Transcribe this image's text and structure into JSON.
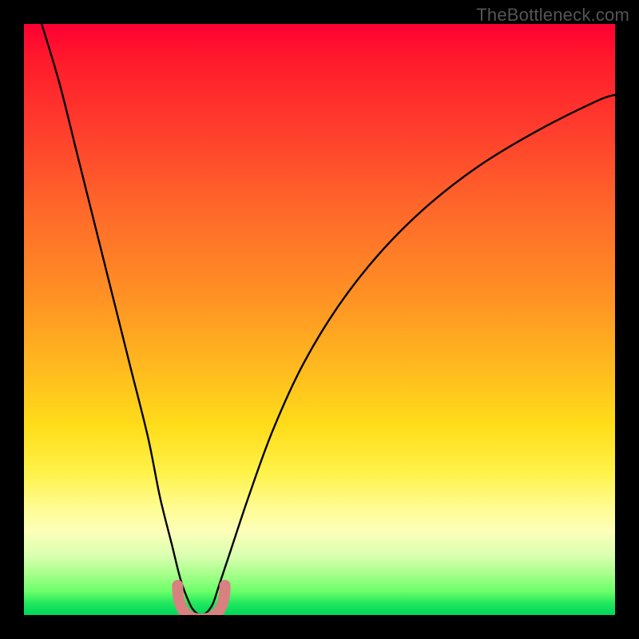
{
  "watermark": "TheBottleneck.com",
  "chart_data": {
    "type": "line",
    "title": "",
    "xlabel": "",
    "ylabel": "",
    "xlim": [
      0,
      100
    ],
    "ylim": [
      0,
      100
    ],
    "legend": false,
    "grid": false,
    "background_gradient": {
      "top": "#ff0033",
      "mid_upper": "#ff8a24",
      "mid": "#ffe61a",
      "mid_lower": "#fbffb9",
      "bottom": "#00d65a"
    },
    "series": [
      {
        "name": "bottleneck-curve",
        "color": "#000000",
        "x": [
          3,
          6,
          9,
          12,
          15,
          18,
          21,
          23,
          25,
          26.5,
          28,
          29,
          30,
          31,
          32,
          33,
          35,
          38,
          42,
          47,
          53,
          60,
          68,
          77,
          87,
          97,
          100
        ],
        "y": [
          100,
          90,
          78,
          66,
          54,
          42,
          30,
          20,
          12,
          6,
          2,
          0.5,
          0,
          0.5,
          2,
          5,
          11,
          20,
          31,
          42,
          52,
          61,
          69,
          76,
          82,
          87,
          88
        ]
      }
    ],
    "markers": [
      {
        "name": "trough-marker",
        "shape": "rounded-u",
        "color": "#d98080",
        "x_center": 30,
        "y_center": 2,
        "width": 8,
        "height": 6
      }
    ]
  }
}
